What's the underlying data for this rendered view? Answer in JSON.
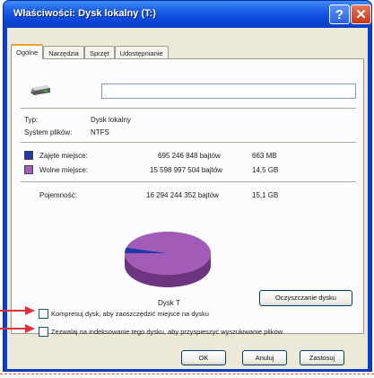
{
  "window": {
    "title": "Właściwości: Dysk lokalny (T:)",
    "help_glyph": "?",
    "close_glyph": "✕"
  },
  "tabs": [
    "Ogólne",
    "Narzędzia",
    "Sprzęt",
    "Udostępnianie"
  ],
  "general": {
    "volume_label": "",
    "type_label": "Typ:",
    "type_value": "Dysk lokalny",
    "fs_label": "System plików:",
    "fs_value": "NTFS",
    "used_label": "Zajęte miejsce:",
    "used_bytes": "695 246 848 bajtów",
    "used_size": "663 MB",
    "free_label": "Wolne miejsce:",
    "free_bytes": "15 598 997 504 bajtów",
    "free_size": "14,5 GB",
    "capacity_label": "Pojemność:",
    "capacity_bytes": "16 294 244 352 bajtów",
    "capacity_size": "15,1 GB",
    "drive_label": "Dysk T",
    "cleanup_button": "Oczyszczanie dysku"
  },
  "options": {
    "compress": "Kompresuj dysk, aby zaoszczędzić miejsce na dysku",
    "index": "Zezwalaj na indeksowanie tego dysku, aby przyspieszyć wyszukiwanie plików"
  },
  "buttons": {
    "ok": "OK",
    "cancel": "Anuluj",
    "apply": "Zastosuj"
  },
  "colors": {
    "used": "#1f3aa6",
    "free": "#a25cb8",
    "titlebar": "#0a48d8",
    "arrow": "#e0303a"
  },
  "chart_data": {
    "type": "pie",
    "categories": [
      "Zajęte miejsce",
      "Wolne miejsce"
    ],
    "values": [
      695246848,
      15598997504
    ]
  }
}
